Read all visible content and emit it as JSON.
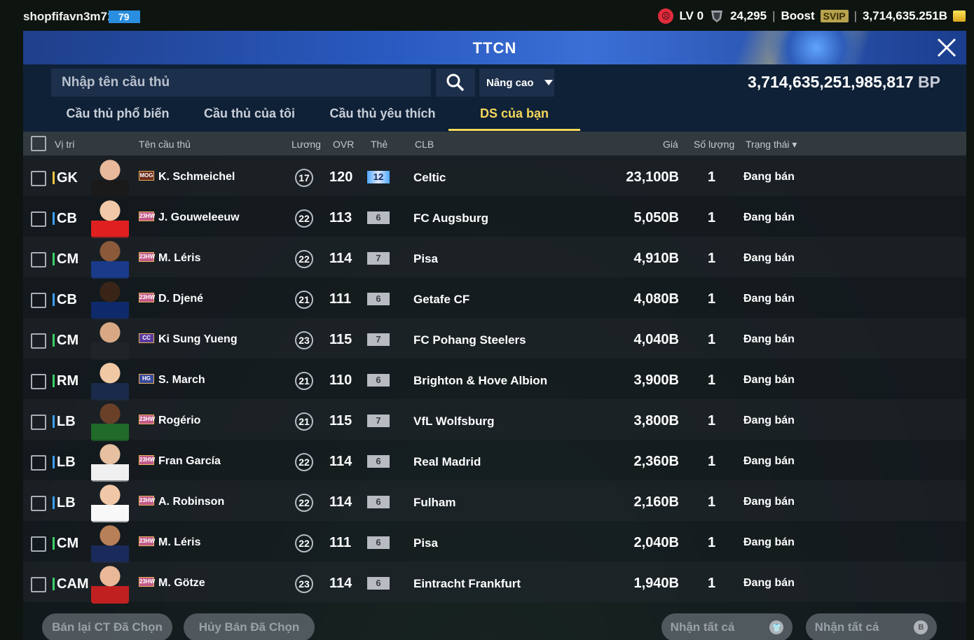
{
  "topbar": {
    "username": "shopfifavn3m71",
    "level": "79",
    "lv_label": "LV 0",
    "points": "24,295",
    "boost_label": "Boost",
    "svip_label": "SVIP",
    "balance": "3,714,635.251B"
  },
  "panel": {
    "title": "TTCN",
    "search_placeholder": "Nhập tên cầu thủ",
    "advanced_label": "Nâng cao",
    "bp_total": "3,714,635,251,985,817",
    "bp_unit": "BP"
  },
  "tabs": [
    {
      "label": "Cầu thủ phổ biến"
    },
    {
      "label": "Cầu thủ của tôi"
    },
    {
      "label": "Cầu thủ yêu thích"
    },
    {
      "label": "DS của bạn"
    }
  ],
  "table_headers": {
    "position": "Vị trí",
    "name": "Tên cầu thủ",
    "wage": "Lương",
    "ovr": "OVR",
    "card": "Thẻ",
    "club": "CLB",
    "price": "Giá",
    "qty": "Số lượng",
    "status": "Trạng thái"
  },
  "rows": [
    {
      "pos": "GK",
      "pos_color": "#f5c542",
      "season": "MOG",
      "season_color": "#6b2a1a",
      "name": "K. Schmeichel",
      "wage": "17",
      "ovr": "120",
      "card": "12",
      "club": "Celtic",
      "price": "23,100B",
      "qty": "1",
      "status": "Đang bán"
    },
    {
      "pos": "CB",
      "pos_color": "#3aa0ff",
      "season": "23HW",
      "season_color": "#c25a8a",
      "name": "J. Gouweleeuw",
      "wage": "22",
      "ovr": "113",
      "card": "6",
      "club": "FC Augsburg",
      "price": "5,050B",
      "qty": "1",
      "status": "Đang bán"
    },
    {
      "pos": "CM",
      "pos_color": "#3ad06a",
      "season": "23HW",
      "season_color": "#c25a8a",
      "name": "M. Léris",
      "wage": "22",
      "ovr": "114",
      "card": "7",
      "club": "Pisa",
      "price": "4,910B",
      "qty": "1",
      "status": "Đang bán"
    },
    {
      "pos": "CB",
      "pos_color": "#3aa0ff",
      "season": "23HW",
      "season_color": "#c25a8a",
      "name": "D. Djené",
      "wage": "21",
      "ovr": "111",
      "card": "6",
      "club": "Getafe CF",
      "price": "4,080B",
      "qty": "1",
      "status": "Đang bán"
    },
    {
      "pos": "CM",
      "pos_color": "#3ad06a",
      "season": "CC",
      "season_color": "#5a3aa0",
      "name": "Ki Sung Yueng",
      "wage": "23",
      "ovr": "115",
      "card": "7",
      "club": "FC Pohang Steelers",
      "price": "4,040B",
      "qty": "1",
      "status": "Đang bán"
    },
    {
      "pos": "RM",
      "pos_color": "#3ad06a",
      "season": "HG",
      "season_color": "#3a4aa0",
      "name": "S. March",
      "wage": "21",
      "ovr": "110",
      "card": "6",
      "club": "Brighton & Hove Albion",
      "price": "3,900B",
      "qty": "1",
      "status": "Đang bán"
    },
    {
      "pos": "LB",
      "pos_color": "#3aa0ff",
      "season": "23HW",
      "season_color": "#c25a8a",
      "name": "Rogério",
      "wage": "21",
      "ovr": "115",
      "card": "7",
      "club": "VfL Wolfsburg",
      "price": "3,800B",
      "qty": "1",
      "status": "Đang bán"
    },
    {
      "pos": "LB",
      "pos_color": "#3aa0ff",
      "season": "23HW",
      "season_color": "#c25a8a",
      "name": "Fran García",
      "wage": "22",
      "ovr": "114",
      "card": "6",
      "club": "Real Madrid",
      "price": "2,360B",
      "qty": "1",
      "status": "Đang bán"
    },
    {
      "pos": "LB",
      "pos_color": "#3aa0ff",
      "season": "23HW",
      "season_color": "#c25a8a",
      "name": "A. Robinson",
      "wage": "22",
      "ovr": "114",
      "card": "6",
      "club": "Fulham",
      "price": "2,160B",
      "qty": "1",
      "status": "Đang bán"
    },
    {
      "pos": "CM",
      "pos_color": "#3ad06a",
      "season": "23HW",
      "season_color": "#c25a8a",
      "name": "M. Léris",
      "wage": "22",
      "ovr": "111",
      "card": "6",
      "club": "Pisa",
      "price": "2,040B",
      "qty": "1",
      "status": "Đang bán"
    },
    {
      "pos": "CAM",
      "pos_color": "#3ad06a",
      "season": "23HW",
      "season_color": "#c25a8a",
      "name": "M. Götze",
      "wage": "23",
      "ovr": "114",
      "card": "6",
      "club": "Eintracht Frankfurt",
      "price": "1,940B",
      "qty": "1",
      "status": "Đang bán"
    }
  ],
  "bottom_buttons": {
    "resell": "Bán lại CT Đã Chọn",
    "cancel": "Hủy Bán Đã Chọn",
    "claim_all_1": "Nhận tất cả",
    "claim_all_2": "Nhận tất cả"
  }
}
